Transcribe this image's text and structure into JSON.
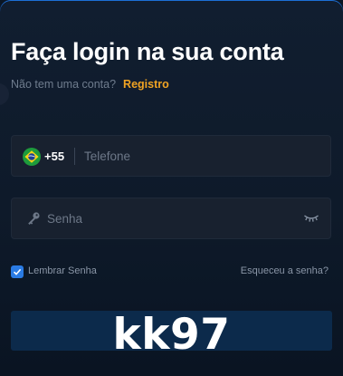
{
  "login": {
    "title": "Faça login na sua conta",
    "no_account_text": "Não tem uma conta?",
    "register_link": "Registro",
    "phone": {
      "country_flag": "brazil-flag-icon",
      "dial_code": "+55",
      "placeholder": "Telefone",
      "value": ""
    },
    "password": {
      "placeholder": "Senha",
      "value": "",
      "leading_icon": "key-icon",
      "toggle_icon": "eye-closed-icon"
    },
    "remember_label": "Lembrar Senha",
    "remember_checked": true,
    "forgot_link": "Esqueceu a senha?",
    "login_button_label": ""
  },
  "watermark": "kk97",
  "colors": {
    "background": "#0e1a2a",
    "accent_link": "#f0a323",
    "checkbox": "#2a7be4",
    "button": "#0c2a4b"
  }
}
